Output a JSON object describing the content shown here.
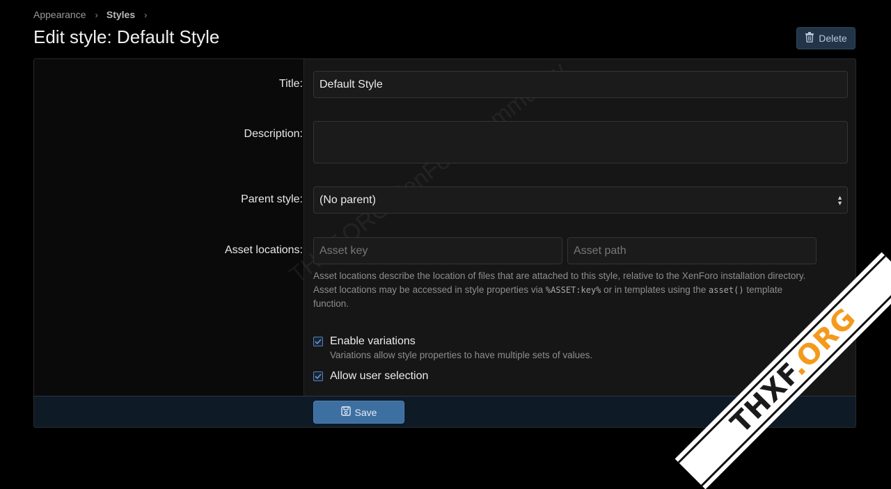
{
  "breadcrumb": {
    "items": [
      "Appearance",
      "Styles"
    ],
    "separator": "›"
  },
  "page": {
    "title": "Edit style: Default Style"
  },
  "actions": {
    "delete_label": "Delete"
  },
  "form": {
    "title_label": "Title:",
    "title_value": "Default Style",
    "description_label": "Description:",
    "description_value": "",
    "parent_label": "Parent style:",
    "parent_value": "(No parent)",
    "assets_label": "Asset locations:",
    "asset_key_placeholder": "Asset key",
    "asset_path_placeholder": "Asset path",
    "explain_1": "Asset locations describe the location of files that are attached to this style, relative to the XenForo installation directory.",
    "explain_2a": "Asset locations may be accessed in style properties via ",
    "explain_code1": "%ASSET:key%",
    "explain_2b": " or in templates using the ",
    "explain_code2": "asset()",
    "explain_2c": " template",
    "explain_3": "function.",
    "variations_label": "Enable variations",
    "variations_checked": true,
    "variations_hint": "Variations allow style properties to have multiple sets of values.",
    "user_selection_label": "Allow user selection",
    "user_selection_checked": true,
    "save_label": "Save"
  },
  "watermark": {
    "text": "THXF.ORG XenForo Community"
  },
  "badge": {
    "text_prefix": "THXF",
    "text_suffix": ".ORG"
  },
  "colors": {
    "accent": "#3d6fa0",
    "delete_bg": "#223447",
    "checkbox": "#4f86c0",
    "badge_accent": "#f39a1e"
  }
}
